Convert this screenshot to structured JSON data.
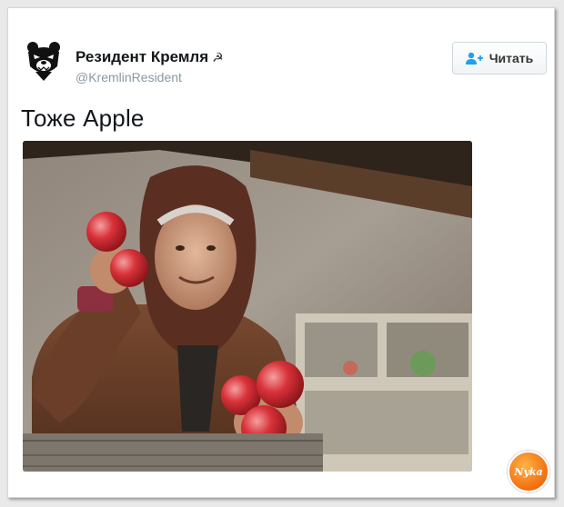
{
  "tweet": {
    "author_name": "Резидент Кремля",
    "author_badge_icon": "hammer-sickle-icon",
    "author_badge_glyph": "☭",
    "author_handle": "@KremlinResident",
    "follow_label": "Читать",
    "text": "Тоже Apple"
  },
  "photo": {
    "subject": "elderly-woman-holding-red-apples"
  },
  "watermark": {
    "text": "Nyka"
  },
  "colors": {
    "name": "#14171a",
    "handle": "#8899a6",
    "follow_icon": "#1da1f2",
    "watermark": "#f26d0f"
  }
}
